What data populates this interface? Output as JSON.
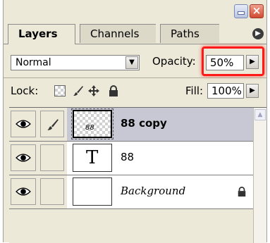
{
  "tabs": [
    {
      "label": "Layers",
      "active": true
    },
    {
      "label": "Channels",
      "active": false
    },
    {
      "label": "Paths",
      "active": false
    }
  ],
  "blend_mode": {
    "value": "Normal"
  },
  "opacity": {
    "label": "Opacity:",
    "value": "50%"
  },
  "lock": {
    "label": "Lock:"
  },
  "fill": {
    "label": "Fill:",
    "value": "100%"
  },
  "layers": [
    {
      "name": "88 copy",
      "thumbnail_text": "88",
      "selected": true,
      "visible": true
    },
    {
      "name": "88",
      "thumbnail_text": "T",
      "selected": false,
      "visible": true
    },
    {
      "name": "Background",
      "selected": false,
      "visible": true,
      "locked": true
    }
  ],
  "colors": {
    "highlight": "#ff1a1a",
    "panel_bg": "#ece9d8",
    "selected_row": "#c8c8d4"
  },
  "icons": [
    "minimize-icon",
    "close-icon",
    "panel-menu-icon",
    "lock-transparent-icon",
    "lock-brush-icon",
    "lock-move-icon",
    "lock-all-icon",
    "eye-icon",
    "brush-icon",
    "lock-icon"
  ]
}
